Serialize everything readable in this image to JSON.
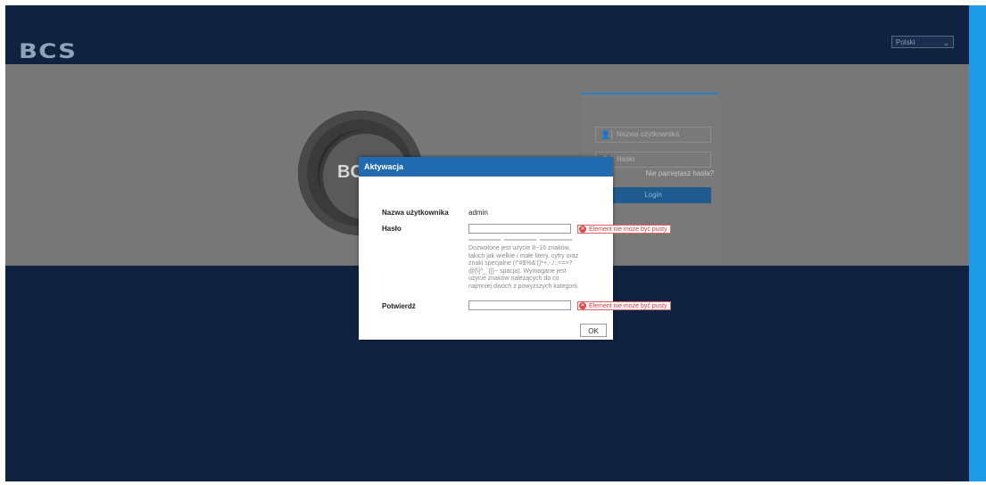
{
  "header": {
    "logo_text": "BCS",
    "language": "Polski"
  },
  "login": {
    "username_placeholder": "Nazwa użytkownika",
    "password_placeholder": "Hasło",
    "forgot_link": "Nie pamiętasz hasła?",
    "login_button": "Login"
  },
  "camera": {
    "brand_text": "BC"
  },
  "modal": {
    "title": "Aktywacja",
    "username_label": "Nazwa użytkownika",
    "username_value": "admin",
    "password_label": "Hasło",
    "password_value": "",
    "confirm_label": "Potwierdź",
    "confirm_value": "",
    "error_text": "Element nie może być pusty",
    "hint_text": "Dozwolone jest użycie 8~16 znaków, takich jak wielkie i małe litery, cyfry oraz znaki specjalne (!\"#$%&'()*+,-./:;<=>?@[\\]^_`{|}~ spacja). Wymagane jest użycie znaków należących do co najmniej dwóch z powyższych kategorii.",
    "ok_label": "OK"
  },
  "colors": {
    "page_background": "#0f2340",
    "band": "#787777",
    "modal_header": "#1f6ab0",
    "accent_strip": "#1e9be6",
    "error": "#d43a3a"
  }
}
